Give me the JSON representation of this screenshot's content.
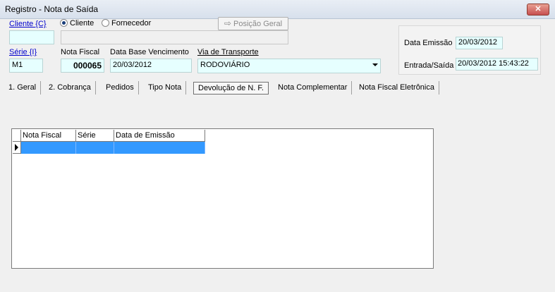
{
  "window": {
    "title": "Registro - Nota de Saída",
    "close_label": "✕"
  },
  "cliente": {
    "label": "Cliente {C}",
    "value": ""
  },
  "radio": {
    "cliente": "Cliente",
    "fornecedor": "Fornecedor",
    "selected": "Cliente"
  },
  "posicao_geral": {
    "label": "Posição Geral"
  },
  "serie": {
    "label": "Série {I}",
    "value": "M1"
  },
  "nota_fiscal": {
    "label": "Nota Fiscal",
    "value": "000065"
  },
  "data_base": {
    "label": "Data Base Vencimento",
    "value": "20/03/2012"
  },
  "via_transporte": {
    "label": "Via de Transporte",
    "value": "RODOVIÁRIO"
  },
  "data_emissao": {
    "label": "Data Emissão",
    "value": "20/03/2012"
  },
  "entrada_saida": {
    "label": "Entrada/Saída",
    "value": "20/03/2012 15:43:22"
  },
  "tabs": [
    {
      "label": "1. Geral"
    },
    {
      "label": "2. Cobrança"
    },
    {
      "label": "Pedidos"
    },
    {
      "label": "Tipo Nota"
    },
    {
      "label": "Devolução de N. F."
    },
    {
      "label": "Nota Complementar"
    },
    {
      "label": "Nota Fiscal Eletrônica"
    }
  ],
  "active_tab": "Devolução de N. F.",
  "grid": {
    "columns": [
      "Nota Fiscal",
      "Série",
      "Data de Emissão"
    ],
    "rows": [
      [
        "",
        "",
        ""
      ]
    ]
  },
  "colors": {
    "selection": "#3399ff",
    "field_bg": "#e6ffff",
    "link": "#0000cc"
  }
}
